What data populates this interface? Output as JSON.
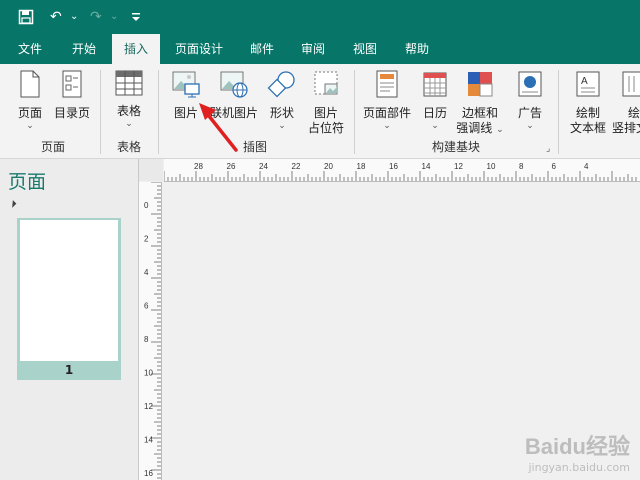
{
  "quick_access": {
    "save_icon": "save-icon",
    "undo_icon": "undo-icon",
    "redo_icon": "redo-icon",
    "customize_icon": "customize-icon",
    "dropdown_mark": "⌄"
  },
  "menu_tabs": [
    "文件",
    "开始",
    "插入",
    "页面设计",
    "邮件",
    "审阅",
    "视图",
    "帮助"
  ],
  "active_tab": "插入",
  "ribbon": {
    "pages_btn": "页面",
    "toc_btn": "目录页",
    "group_pages": "页面",
    "table_btn": "表格",
    "group_table": "表格",
    "picture_btn": "图片",
    "online_picture_btn": "联机图片",
    "shapes_btn": "形状",
    "placeholder_btn_line1": "图片",
    "placeholder_btn_line2": "占位符",
    "group_illustrations": "插图",
    "page_parts_btn": "页面部件",
    "calendar_btn": "日历",
    "borders_btn_line1": "边框和",
    "borders_btn_line2": "强调线",
    "ads_btn": "广告",
    "group_building_blocks": "构建基块",
    "draw_textbox_line1": "绘制",
    "draw_textbox_line2": "文本框",
    "vertical_textbox_line1": "绘",
    "vertical_textbox_line2": "竖排文"
  },
  "left_pane": {
    "title": "页面",
    "page_number": "1"
  },
  "ruler_h": [
    "28",
    "26",
    "24",
    "22",
    "20",
    "18",
    "16",
    "14",
    "12",
    "10",
    "8",
    "6",
    "4"
  ],
  "ruler_v": [
    "0",
    "2",
    "4",
    "6",
    "8",
    "10",
    "12",
    "14",
    "16"
  ],
  "watermark": {
    "brand": "Baidu经验",
    "url": "jingyan.baidu.com"
  },
  "colors": {
    "brand_green": "#077568",
    "arrow_red": "#e02020"
  }
}
